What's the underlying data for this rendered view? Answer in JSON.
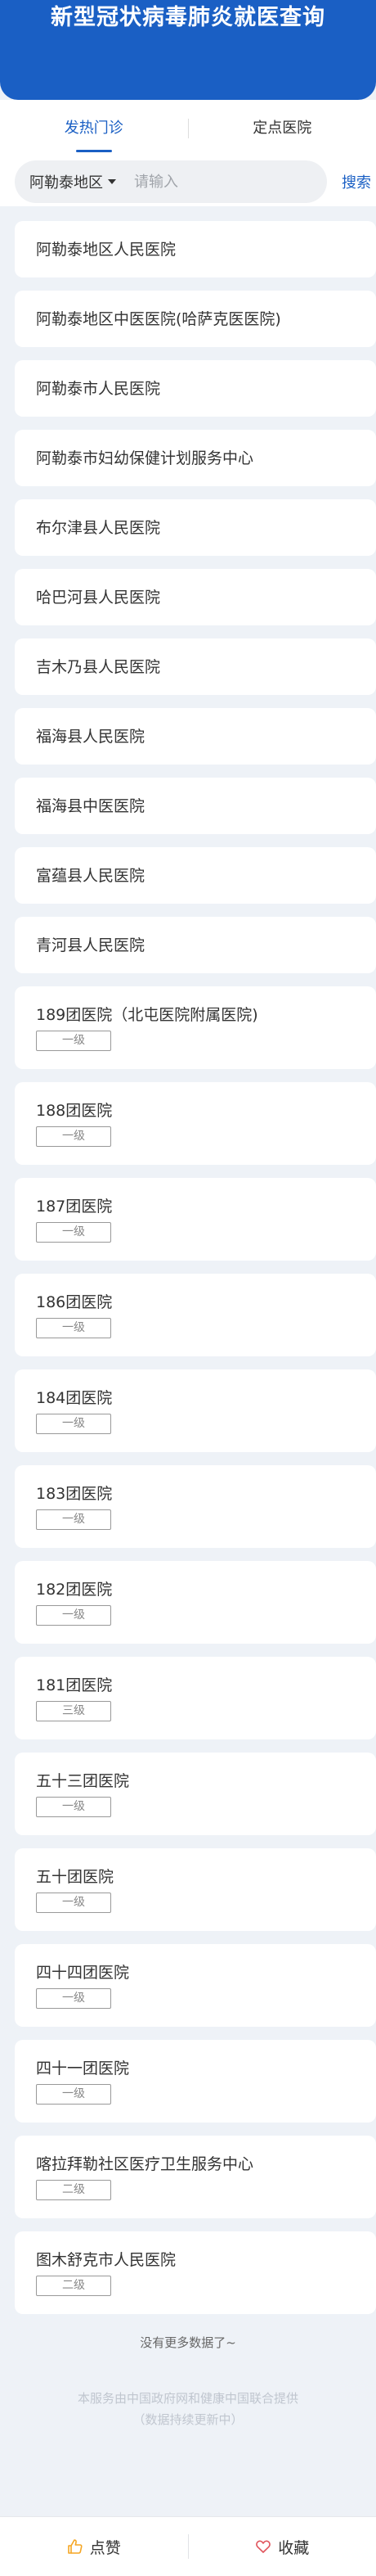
{
  "header": {
    "title": "新型冠状病毒肺炎就医查询"
  },
  "tabs": [
    {
      "label": "发热门诊",
      "active": true
    },
    {
      "label": "定点医院",
      "active": false
    }
  ],
  "search": {
    "region": "阿勒泰地区",
    "placeholder": "请输入",
    "button": "搜索"
  },
  "hospitals": [
    {
      "name": "阿勒泰地区人民医院",
      "level": ""
    },
    {
      "name": "阿勒泰地区中医医院(哈萨克医医院)",
      "level": ""
    },
    {
      "name": "阿勒泰市人民医院",
      "level": ""
    },
    {
      "name": "阿勒泰市妇幼保健计划服务中心",
      "level": ""
    },
    {
      "name": "布尔津县人民医院",
      "level": ""
    },
    {
      "name": "哈巴河县人民医院",
      "level": ""
    },
    {
      "name": "吉木乃县人民医院",
      "level": ""
    },
    {
      "name": "福海县人民医院",
      "level": ""
    },
    {
      "name": "福海县中医医院",
      "level": ""
    },
    {
      "name": "富蕴县人民医院",
      "level": ""
    },
    {
      "name": "青河县人民医院",
      "level": ""
    },
    {
      "name": "189团医院（北屯医院附属医院)",
      "level": "一级"
    },
    {
      "name": "188团医院",
      "level": "一级"
    },
    {
      "name": "187团医院",
      "level": "一级"
    },
    {
      "name": "186团医院",
      "level": "一级"
    },
    {
      "name": "184团医院",
      "level": "一级"
    },
    {
      "name": "183团医院",
      "level": "一级"
    },
    {
      "name": "182团医院",
      "level": "一级"
    },
    {
      "name": "181团医院",
      "level": "三级"
    },
    {
      "name": "五十三团医院",
      "level": "一级"
    },
    {
      "name": "五十团医院",
      "level": "一级"
    },
    {
      "name": "四十四团医院",
      "level": "一级"
    },
    {
      "name": "四十一团医院",
      "level": "一级"
    },
    {
      "name": "喀拉拜勒社区医疗卫生服务中心",
      "level": "二级"
    },
    {
      "name": "图木舒克市人民医院",
      "level": "二级"
    }
  ],
  "no_more": "没有更多数据了~",
  "footer_note": {
    "line1": "本服务由中国政府网和健康中国联合提供",
    "line2": "（数据持续更新中）"
  },
  "bottom_bar": {
    "like_label": "点赞",
    "like_icon": "thumbs-up-icon",
    "favorite_label": "收藏",
    "favorite_icon": "heart-icon"
  },
  "colors": {
    "primary": "#1a5fc4",
    "background": "#eef2f7",
    "like_icon": "#f5a623",
    "favorite_icon": "#e0545c"
  }
}
